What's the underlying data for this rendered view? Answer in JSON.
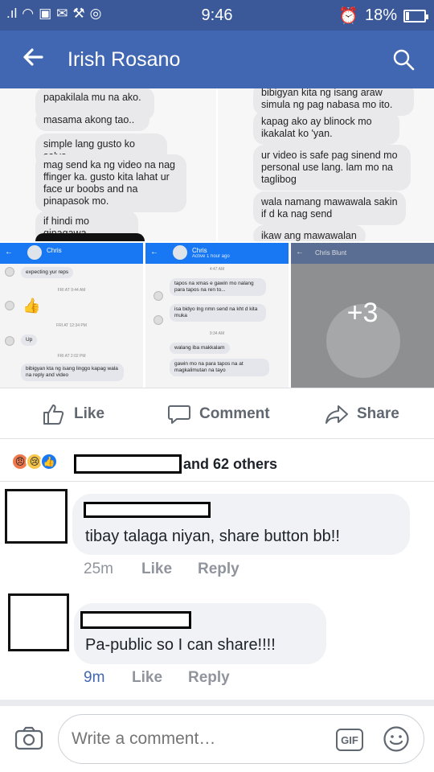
{
  "status_bar": {
    "time": "9:46",
    "battery": "18%",
    "battery_level": 0.18
  },
  "header": {
    "title": "Irish Rosano",
    "back_icon": "back-arrow-icon",
    "search_icon": "search-icon"
  },
  "photos": {
    "top_left": [
      "papakilala mu na ako. . .",
      "masama akong tao..",
      "simple lang gusto ko sa'yo..",
      "mag send ka ng video na nag ffinger ka. gusto kita lahat ur face ur boobs and na pinapasok mo.",
      "if hindi mo ginagawa"
    ],
    "top_right": [
      "bibigyan kita ng isang araw simula ng pag nabasa mo ito.",
      "kapag ako ay blinock mo ikakalat ko 'yan.",
      "ur video is safe pag sinend mo personal use lang. lam mo na taglibog",
      "wala namang mawawala sakin if d ka nag send",
      "ikaw ang mawawalan"
    ],
    "thumb1": {
      "name": "Chris",
      "msgs": [
        "expecting yur reps",
        "Up",
        "bibigyan kta ng isang linggo kapag wala na reply and video"
      ],
      "timestamps": [
        "FRI AT 9:44 AM",
        "FRI AT 12:34 PM",
        "FRI AT 2:02 PM"
      ]
    },
    "thumb2": {
      "name": "Chris",
      "status": "Active 1 hour ago",
      "msgs": [
        "tapos na xmas e gawin mo nalang para tapos na ren to...",
        "isa bidyo lng nmn send na kht d kita muka",
        "walang iba makkalam",
        "gawin mo na para tapos na at magkalimutan na tayo"
      ],
      "timestamps": [
        "4:47 AM",
        "9:34 AM"
      ]
    },
    "thumb3": {
      "name": "Chris Blunt",
      "more_label": "+3"
    }
  },
  "actions": {
    "like": "Like",
    "comment": "Comment",
    "share": "Share"
  },
  "reactions": {
    "others_label": "and 62 others",
    "icons": [
      "angry-react-icon",
      "sad-react-icon",
      "like-react-icon"
    ]
  },
  "comments": [
    {
      "text": "tibay talaga niyan,  share button bb!!",
      "time": "25m",
      "like": "Like",
      "reply": "Reply"
    },
    {
      "text": "Pa-public so I can share!!!!",
      "time": "9m",
      "like": "Like",
      "reply": "Reply"
    }
  ],
  "composer": {
    "placeholder": "Write a comment…",
    "gif_label": "GIF"
  },
  "colors": {
    "header": "#4267b2",
    "status_bar": "#3b5998",
    "messenger_blue": "#1877f2",
    "meta_gray": "#90949c",
    "link_blue": "#4267b2"
  }
}
